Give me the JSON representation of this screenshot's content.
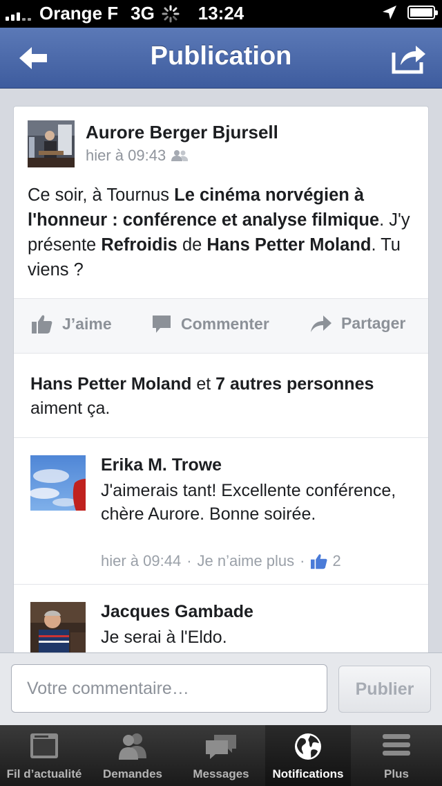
{
  "status_bar": {
    "carrier": "Orange F",
    "network": "3G",
    "time": "13:24"
  },
  "navbar": {
    "title": "Publication",
    "back_icon": "back-arrow-icon",
    "share_icon": "share-icon"
  },
  "post": {
    "author": "Aurore Berger Bjursell",
    "timestamp": "hier à 09:43",
    "audience_icon": "friends-icon",
    "text_parts": [
      {
        "t": "Ce soir,  à Tournus ",
        "b": false
      },
      {
        "t": "Le cinéma norvégien à l'honneur : conférence et analyse filmique",
        "b": true
      },
      {
        "t": ". J'y présente ",
        "b": false
      },
      {
        "t": "Refroidis",
        "b": true
      },
      {
        "t": " de ",
        "b": false
      },
      {
        "t": "Hans Petter Moland",
        "b": true
      },
      {
        "t": ". Tu viens ?",
        "b": false
      }
    ]
  },
  "actions": {
    "like": "J’aime",
    "comment": "Commenter",
    "share": "Partager"
  },
  "likes_summary": {
    "name": "Hans Petter Moland",
    "connector": " et ",
    "others": "7 autres personnes",
    "suffix": " aiment ça."
  },
  "comments": [
    {
      "author": "Erika M. Trowe",
      "text": "J'aimerais tant! Excellente conférence, chère Aurore. Bonne soirée.",
      "timestamp": "hier à 09:44",
      "separator": " · ",
      "unlike": "Je n’aime plus",
      "likes": "2"
    },
    {
      "author": "Jacques Gambade",
      "text": "Je serai à l'Eldo."
    }
  ],
  "composer": {
    "placeholder": "Votre commentaire…",
    "publish": "Publier"
  },
  "tabs": [
    {
      "label": "Fil d’actualité",
      "icon": "news-feed-icon"
    },
    {
      "label": "Demandes",
      "icon": "friend-requests-icon"
    },
    {
      "label": "Messages",
      "icon": "messages-icon"
    },
    {
      "label": "Notifications",
      "icon": "globe-icon",
      "active": true
    },
    {
      "label": "Plus",
      "icon": "menu-icon"
    }
  ],
  "colors": {
    "nav_blue": "#3e5c9e",
    "like_blue": "#4a7bd8"
  }
}
